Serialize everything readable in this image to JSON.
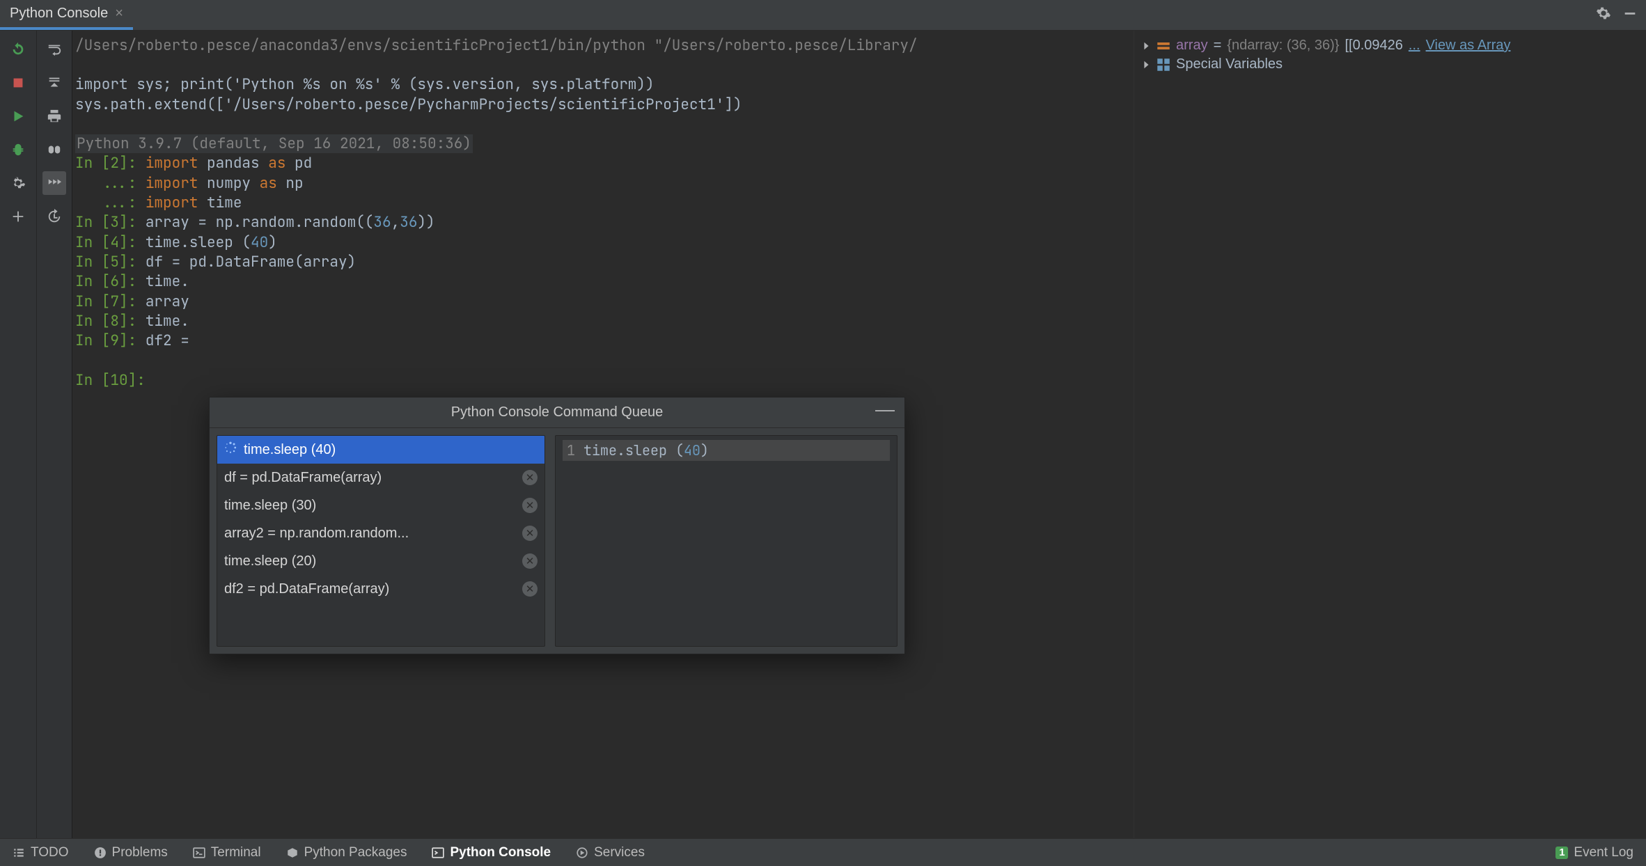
{
  "tab": {
    "title": "Python Console"
  },
  "console": {
    "interpreter_path": "/Users/roberto.pesce/anaconda3/envs/scientificProject1/bin/python \"/Users/roberto.pesce/Library/",
    "line_import_sys": "import sys; print('Python %s on %s' % (sys.version, sys.platform))",
    "line_syspath": "sys.path.extend(['/Users/roberto.pesce/PycharmProjects/scientificProject1'])",
    "version_line": "Python 3.9.7 (default, Sep 16 2021, 08:50:36)",
    "in2_prompt": "In [2]: ",
    "in2_import_kw": "import",
    "in2_pandas": " pandas ",
    "in2_as": "as",
    "in2_pd": " pd",
    "in2_cont_prompt": "   ...: ",
    "in2_numpy": " numpy ",
    "in2_np": " np",
    "in2_time": " time",
    "in3_prompt": "In [3]: ",
    "in3_text": "array = np.random.random((",
    "in3_n1": "36",
    "in3_comma": ",",
    "in3_n2": "36",
    "in3_close": "))",
    "in4_prompt": "In [4]: ",
    "in4_text": "time.sleep (",
    "in4_num": "40",
    "in4_close": ")",
    "in5_prompt": "In [5]: ",
    "in5_text": "df = pd.DataFrame(array)",
    "in6_prompt": "In [6]: ",
    "in6_text": "time.",
    "in7_prompt": "In [7]: ",
    "in7_text": "array",
    "in8_prompt": "In [8]: ",
    "in8_text": "time.",
    "in9_prompt": "In [9]: ",
    "in9_text": "df2 =",
    "in10_prompt": "In [10]:"
  },
  "popup": {
    "title": "Python Console Command Queue",
    "items": [
      {
        "label": "time.sleep (40)",
        "selected": true,
        "running": true
      },
      {
        "label": "df = pd.DataFrame(array)",
        "selected": false
      },
      {
        "label": "time.sleep (30)",
        "selected": false
      },
      {
        "label": "array2 = np.random.random...",
        "selected": false
      },
      {
        "label": "time.sleep (20)",
        "selected": false
      },
      {
        "label": "df2 = pd.DataFrame(array)",
        "selected": false
      }
    ],
    "right_ln": "1",
    "right_code_pre": "time.sleep (",
    "right_code_num": "40",
    "right_code_post": ")"
  },
  "vars": {
    "array_name": "array",
    "array_eq": " = ",
    "array_type": "{ndarray: (36, 36)}",
    "array_preview": " [[0.09426",
    "array_ellips": "...",
    "view_as_array": "View as Array",
    "special_vars": "Special Variables"
  },
  "statusbar": {
    "todo": "TODO",
    "problems": "Problems",
    "terminal": "Terminal",
    "packages": "Python Packages",
    "console": "Python Console",
    "services": "Services",
    "eventlog_badge": "1",
    "eventlog": "Event Log"
  }
}
